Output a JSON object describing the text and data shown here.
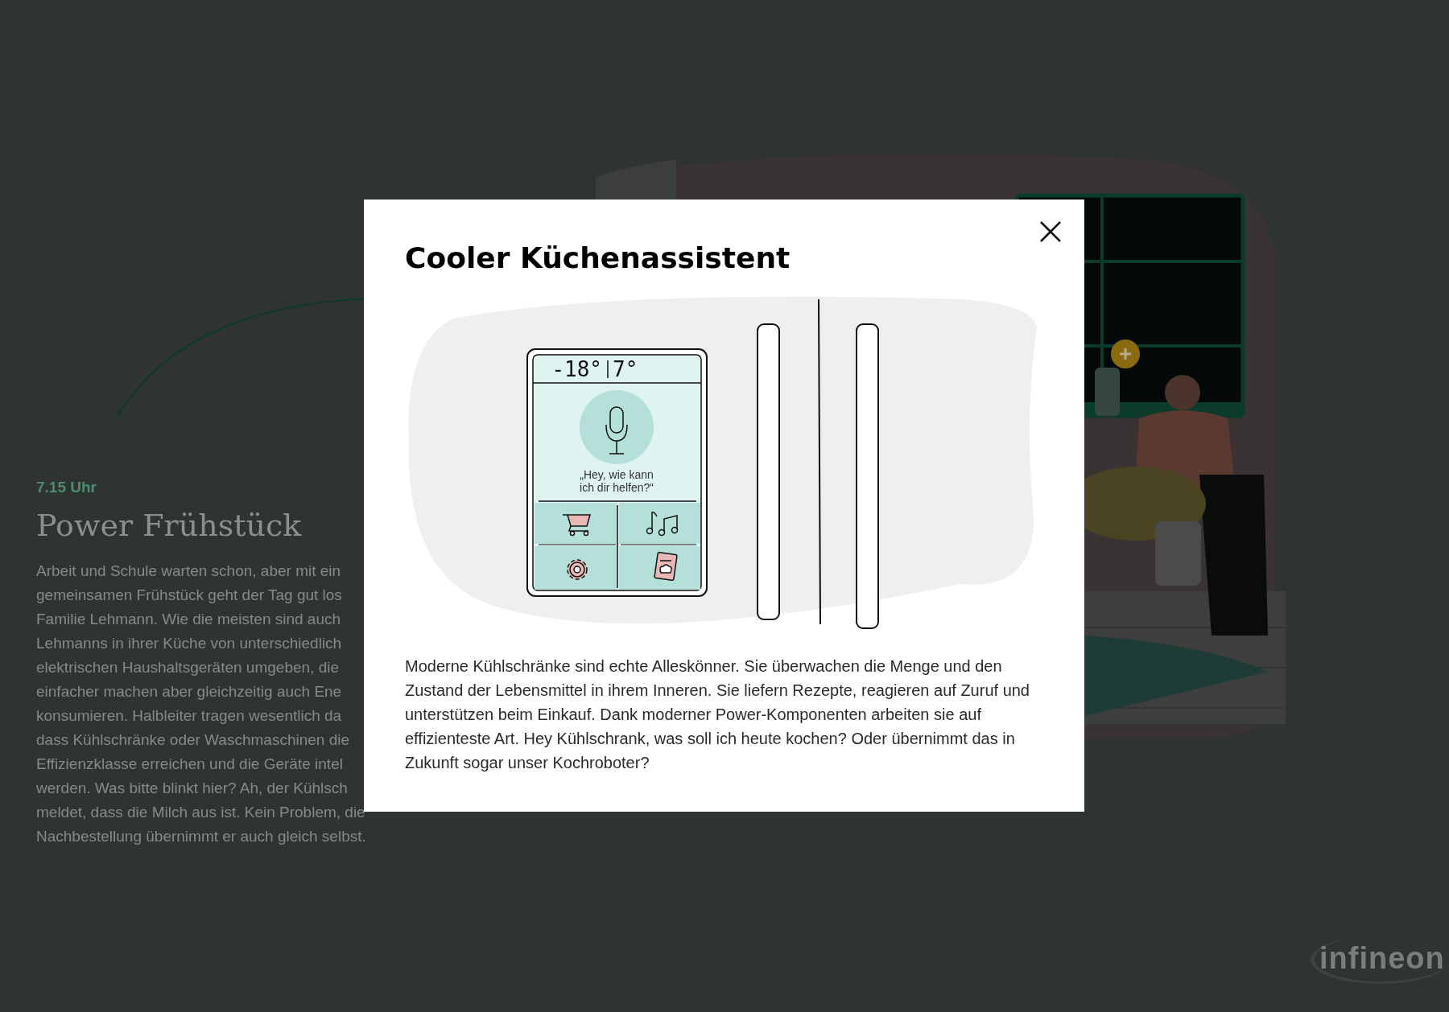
{
  "section": {
    "time": "7.15 Uhr",
    "heading": "Power Frühstück",
    "paragraph_lines": [
      "Arbeit und Schule warten schon, aber mit ein",
      "gemeinsamen Frühstück geht der Tag gut los",
      "Familie Lehmann. Wie die meisten sind auch",
      "Lehmanns in ihrer Küche von unterschiedlich",
      "elektrischen Haushaltsgeräten umgeben, die",
      "einfacher machen aber gleichzeitig auch Ene",
      "konsumieren. Halbleiter tragen wesentlich da",
      "dass Kühlschränke oder Waschmaschinen die",
      "Effizienzklasse erreichen und die Geräte intel",
      "werden. Was bitte blinkt hier? Ah, der Kühlsch",
      "meldet, dass die Milch aus ist. Kein Problem, die",
      "Nachbestellung übernimmt er auch gleich selbst."
    ]
  },
  "modal": {
    "title": "Cooler Küchenassistent",
    "illustration": {
      "display_left": "-18°",
      "display_right": "7°",
      "prompt_lines": [
        "„Hey, wie kann",
        "ich dir helfen?“"
      ]
    },
    "body": "Moderne Kühlschränke sind echte Alleskönner. Sie überwachen die Menge und den Zustand der Lebensmittel in ihrem Inneren. Sie liefern Rezepte, reagieren auf Zuruf und unterstützen beim Einkauf. Dank moderner Power-Komponenten arbeiten sie auf effizienteste Art. Hey Kühlschrank, was soll ich heute kochen? Oder übernimmt das in Zukunft sogar unser Kochroboter?"
  },
  "logo": "infineon"
}
